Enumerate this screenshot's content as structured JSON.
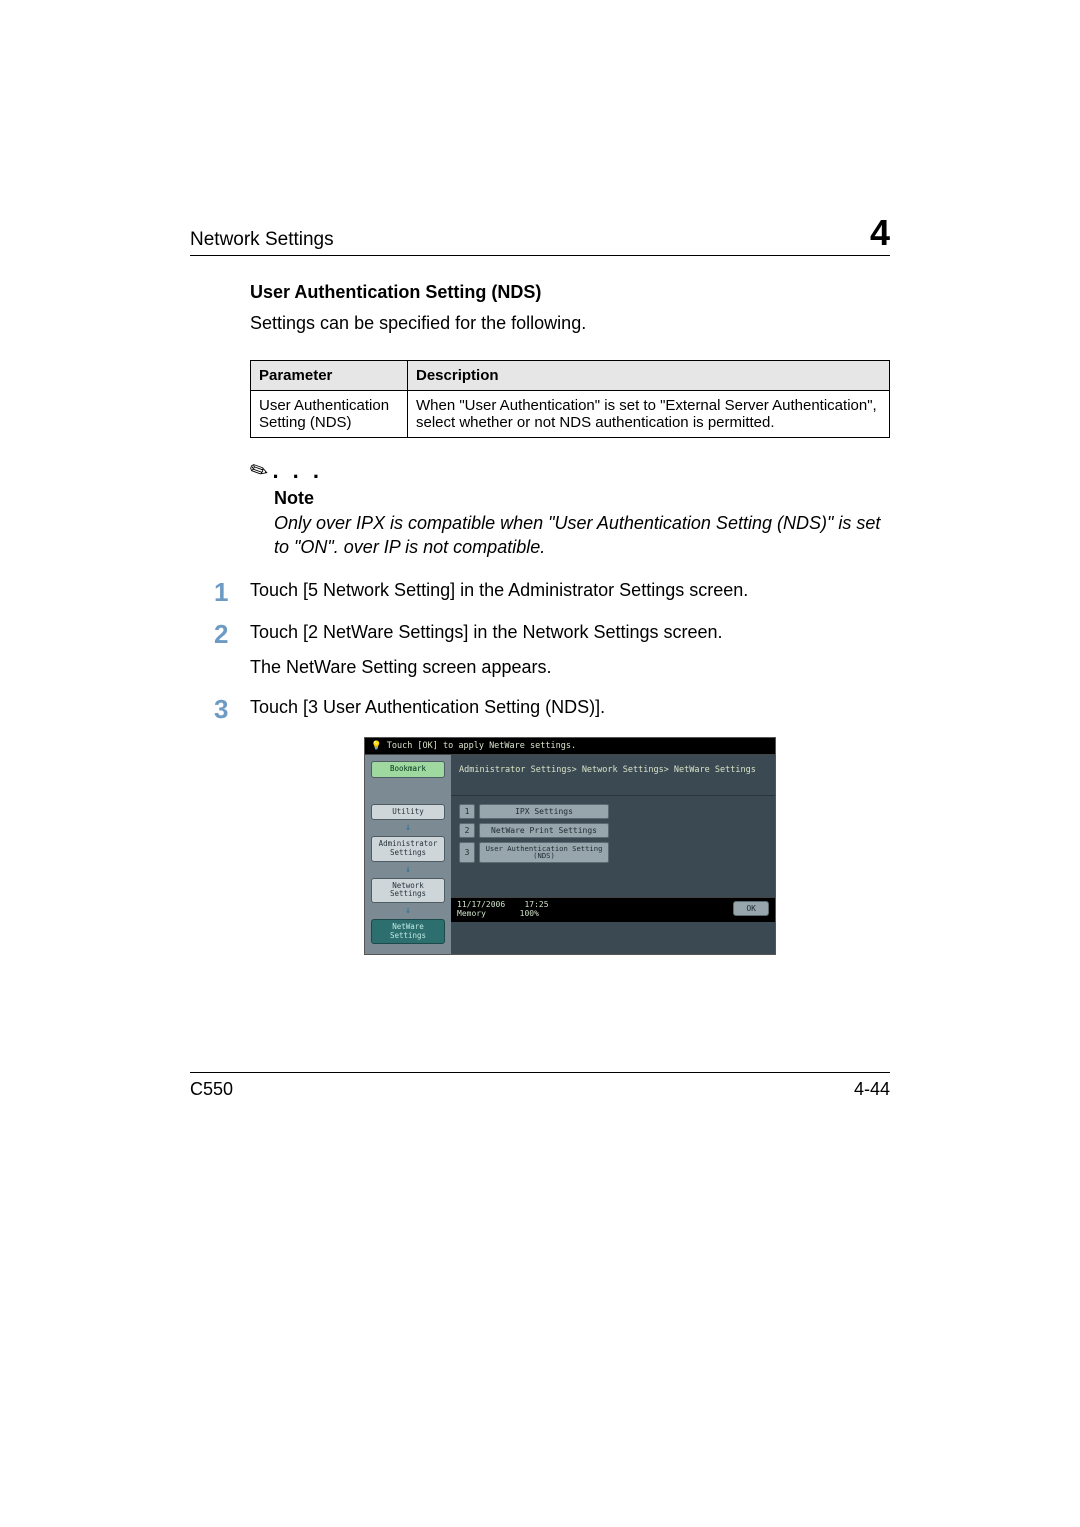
{
  "header": {
    "running_title": "Network Settings",
    "chapter_number": "4"
  },
  "section": {
    "heading": "User Authentication Setting (NDS)",
    "intro": "Settings can be specified for the following."
  },
  "table": {
    "headers": {
      "param": "Parameter",
      "desc": "Description"
    },
    "row": {
      "param": "User Authentication Setting (NDS)",
      "desc": "When \"User Authentication\" is set to \"External Server Authentication\", select whether or not NDS authentication is permitted."
    }
  },
  "note": {
    "title": "Note",
    "body": "Only over IPX is compatible when \"User Authentication Setting (NDS)\" is set to \"ON\". over IP is not compatible."
  },
  "steps": [
    {
      "num": "1",
      "text": "Touch [5 Network Setting] in the Administrator Settings screen."
    },
    {
      "num": "2",
      "text": "Touch [2 NetWare Settings] in the Network Settings screen.",
      "sub": "The NetWare Setting screen appears."
    },
    {
      "num": "3",
      "text": "Touch [3 User Authentication Setting (NDS)]."
    }
  ],
  "device": {
    "hint": "Touch [OK] to apply NetWare settings.",
    "breadcrumb": "Administrator Settings> Network Settings> NetWare Settings",
    "sidebar": {
      "bookmark": "Bookmark",
      "utility": "Utility",
      "admin": "Administrator Settings",
      "network": "Network Settings",
      "netware": "NetWare Settings"
    },
    "menu": [
      {
        "n": "1",
        "label": "IPX Settings"
      },
      {
        "n": "2",
        "label": "NetWare Print Settings"
      },
      {
        "n": "3",
        "label": "User Authentication Setting (NDS)"
      }
    ],
    "status": {
      "date": "11/17/2006",
      "time": "17:25",
      "memory_label": "Memory",
      "memory_value": "100%",
      "ok": "OK"
    }
  },
  "footer": {
    "model": "C550",
    "page": "4-44"
  }
}
